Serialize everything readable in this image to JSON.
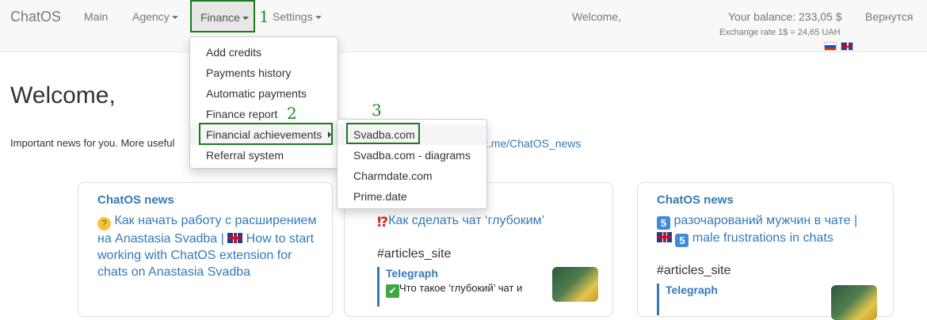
{
  "navbar": {
    "brand": "ChatOS",
    "items": [
      {
        "label": "Main"
      },
      {
        "label": "Agency"
      },
      {
        "label": "Finance"
      },
      {
        "label": "Settings"
      }
    ],
    "welcome": "Welcome,",
    "balance": "Your balance: 233,05 $",
    "exchange_rate": "Exchange rate 1$ = 24,65 UAH",
    "back_link": "Вернутся",
    "flags": [
      "ru-flag-icon",
      "gb-flag-icon"
    ]
  },
  "annotations": {
    "step1": "1",
    "step2": "2",
    "step3": "3"
  },
  "finance_menu": {
    "items": [
      {
        "label": "Add credits"
      },
      {
        "label": "Payments history"
      },
      {
        "label": "Automatic payments"
      },
      {
        "label": "Finance report"
      },
      {
        "label": "Financial achievements"
      },
      {
        "label": "Referral system"
      }
    ]
  },
  "achievements_submenu": {
    "items": [
      {
        "label": "Svadba.com"
      },
      {
        "label": "Svadba.com - diagrams"
      },
      {
        "label": "Charmdate.com"
      },
      {
        "label": "Prime.date"
      }
    ]
  },
  "main": {
    "title": "Welcome,",
    "news_text": "Important news for you. More useful",
    "news_link": "t.me/ChatOS_news"
  },
  "cards": [
    {
      "title": "ChatOS news",
      "text_1": "Как начать работу с расширением на Anastasia Svadba |",
      "text_2": "How to start working with ChatOS extension for chats on Anastasia Svadba"
    },
    {
      "text": "Как сделать чат ‘глубоким’",
      "tag": "#articles_site",
      "telegraph_label": "Telegraph",
      "telegraph_text": "Что такое ‘глубокий’ чат и"
    },
    {
      "title": "ChatOS news",
      "text_1": "разочарований мужчин в чате |",
      "text_2": "male frustrations in chats",
      "five": "5",
      "tag": "#articles_site",
      "telegraph_label": "Telegraph"
    }
  ],
  "colors": {
    "link": "#337ab7",
    "annotation_green": "#1a7a1a",
    "navbar_bg": "#f8f8f8"
  }
}
